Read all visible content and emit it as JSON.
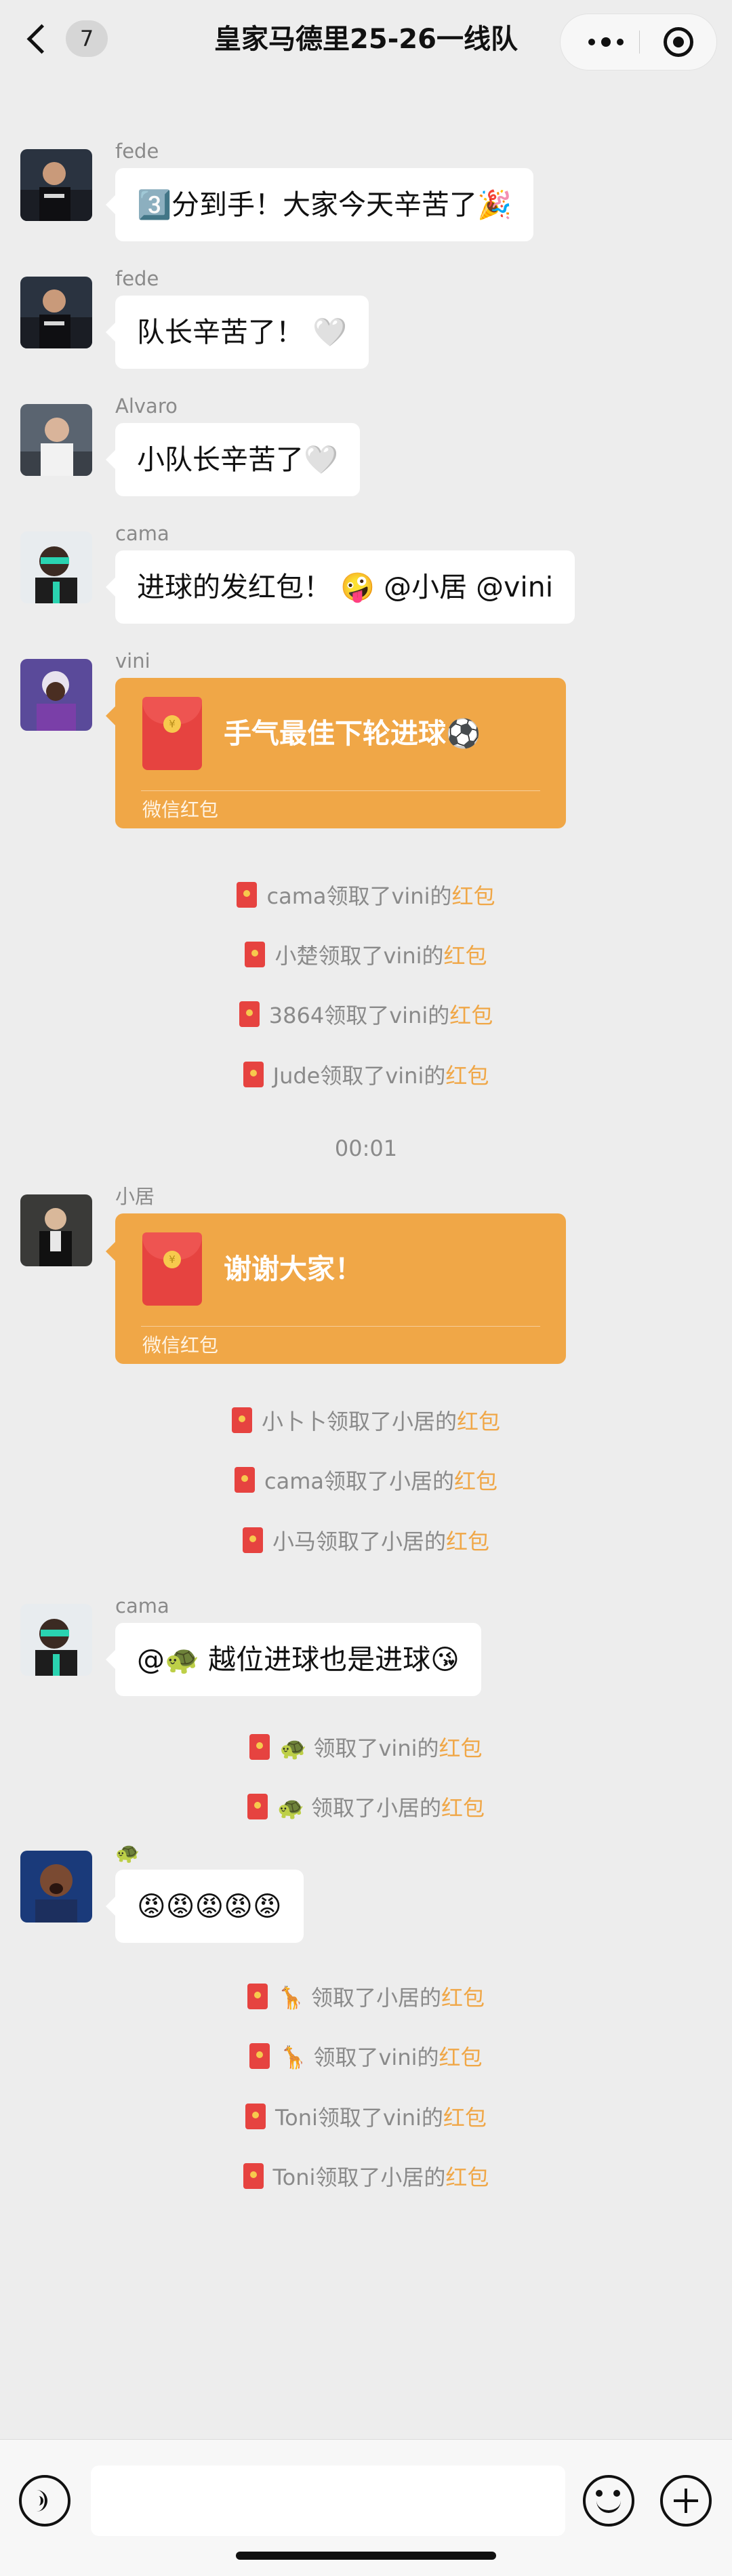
{
  "header": {
    "unread_count": "7",
    "title": "皇家马德里25-26一线队"
  },
  "messages": [
    {
      "sender": "fede",
      "text": "3️⃣分到手！大家今天辛苦了🎉"
    },
    {
      "sender": "fede",
      "text": "队长辛苦了！ 🤍"
    },
    {
      "sender": "Alvaro",
      "text": "小队长辛苦了🤍"
    },
    {
      "sender": "cama",
      "text": "进球的发红包！ 🤪 @小居 @vini"
    },
    {
      "sender": "vini",
      "packet_text": "手气最佳下轮进球⚽",
      "packet_footer": "微信红包"
    },
    {
      "sender": "小居",
      "packet_text": "谢谢大家！",
      "packet_footer": "微信红包"
    },
    {
      "sender": "cama",
      "text": "@🐢 越位进球也是进球😘"
    },
    {
      "sender": "🐢",
      "text": "😡😡😡😡😡"
    }
  ],
  "time_divider": "00:01",
  "system_notices": {
    "group1": [
      {
        "text": "cama领取了vini的",
        "link": "红包"
      },
      {
        "text": "小楚领取了vini的",
        "link": "红包"
      },
      {
        "text": "3864领取了vini的",
        "link": "红包"
      },
      {
        "text": "Jude领取了vini的",
        "link": "红包"
      }
    ],
    "group2": [
      {
        "text": "小卜卜领取了小居的",
        "link": "红包"
      },
      {
        "text": "cama领取了小居的",
        "link": "红包"
      },
      {
        "text": "小马领取了小居的",
        "link": "红包"
      }
    ],
    "group3": [
      {
        "text": "🐢 领取了vini的",
        "link": "红包"
      },
      {
        "text": "🐢 领取了小居的",
        "link": "红包"
      }
    ],
    "group4": [
      {
        "text": "🦒 领取了小居的",
        "link": "红包"
      },
      {
        "text": "🦒 领取了vini的",
        "link": "红包"
      },
      {
        "text": "Toni领取了vini的",
        "link": "红包"
      },
      {
        "text": "Toni领取了小居的",
        "link": "红包"
      }
    ]
  },
  "input": {
    "value": "",
    "placeholder": ""
  },
  "colors": {
    "packet": "#f0a747",
    "link": "#f0a747",
    "background": "#ededed"
  }
}
